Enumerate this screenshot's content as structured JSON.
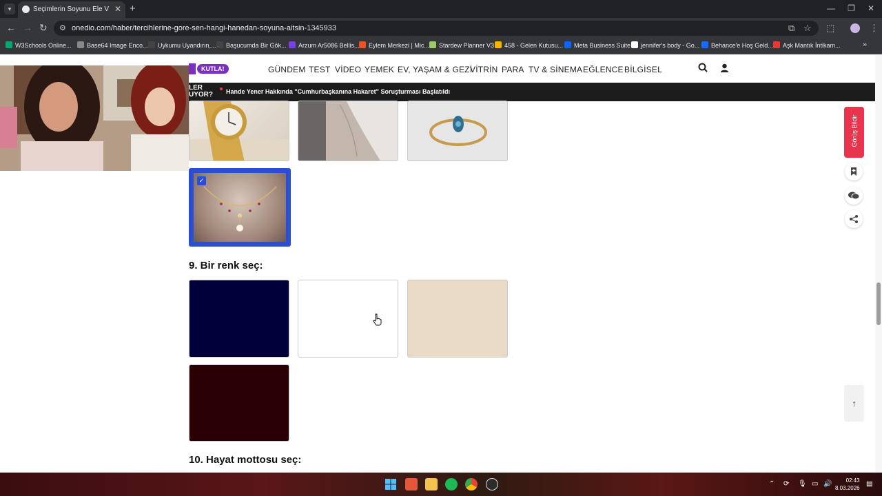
{
  "browser": {
    "tab_title": "Seçimlerin Soyunu Ele Veriyor!",
    "url": "onedio.com/haber/tercihlerine-gore-sen-hangi-hanedan-soyuna-aitsin-1345933",
    "bookmarks": [
      {
        "label": "W3Schools Online...",
        "color": "#04aa6d"
      },
      {
        "label": "Base64 Image Enco...",
        "color": "#888888"
      },
      {
        "label": "Uykumu Uyandırın,...",
        "color": "#444444"
      },
      {
        "label": "Başucumda Bir Gök...",
        "color": "#444444"
      },
      {
        "label": "Arzum Ar5086 Bellis...",
        "color": "#7b3fe4"
      },
      {
        "label": "Eylem Merkezi | Mic...",
        "color": "#f25022"
      },
      {
        "label": "Stardew Planner V3",
        "color": "#9ccc65"
      },
      {
        "label": "458 - Gelen Kutusu...",
        "color": "#f4b400"
      },
      {
        "label": "Meta Business Suite",
        "color": "#0866ff"
      },
      {
        "label": "jennifer's body - Go...",
        "color": "#ffffff"
      },
      {
        "label": "Behance'e Hoş Geld...",
        "color": "#1769ff"
      },
      {
        "label": "Aşk Mantık İntikam...",
        "color": "#e53935"
      }
    ]
  },
  "site": {
    "badge": "KUTLA!",
    "nav": [
      "GÜNDEM",
      "TEST",
      "VİDEO",
      "YEMEK",
      "EV, YAŞAM & GEZİ",
      "VİTRİN",
      "PARA",
      "TV & SİNEMA",
      "EĞLENCE",
      "BİLGİSEL"
    ],
    "ticker_label_line1": "LER",
    "ticker_label_line2": "UYOR?",
    "ticker_news": "Hande Yener Hakkında \"Cumhurbaşkanına Hakaret\" Soruşturması Başlatıldı"
  },
  "quiz": {
    "jewelry_options": [
      "watch",
      "bracelet",
      "ring",
      "necklace"
    ],
    "selected_jewelry": "necklace",
    "q9_title": "9. Bir renk seç:",
    "colors": [
      "#00003a",
      "#ffffff",
      "#e8dac3",
      "#2a0005"
    ],
    "q10_title": "10. Hayat mottosu seç:"
  },
  "side": {
    "feedback": "Görüş Bildir",
    "totop": "↑"
  },
  "taskbar": {
    "time": "02:43",
    "date": "8.03.2026"
  }
}
